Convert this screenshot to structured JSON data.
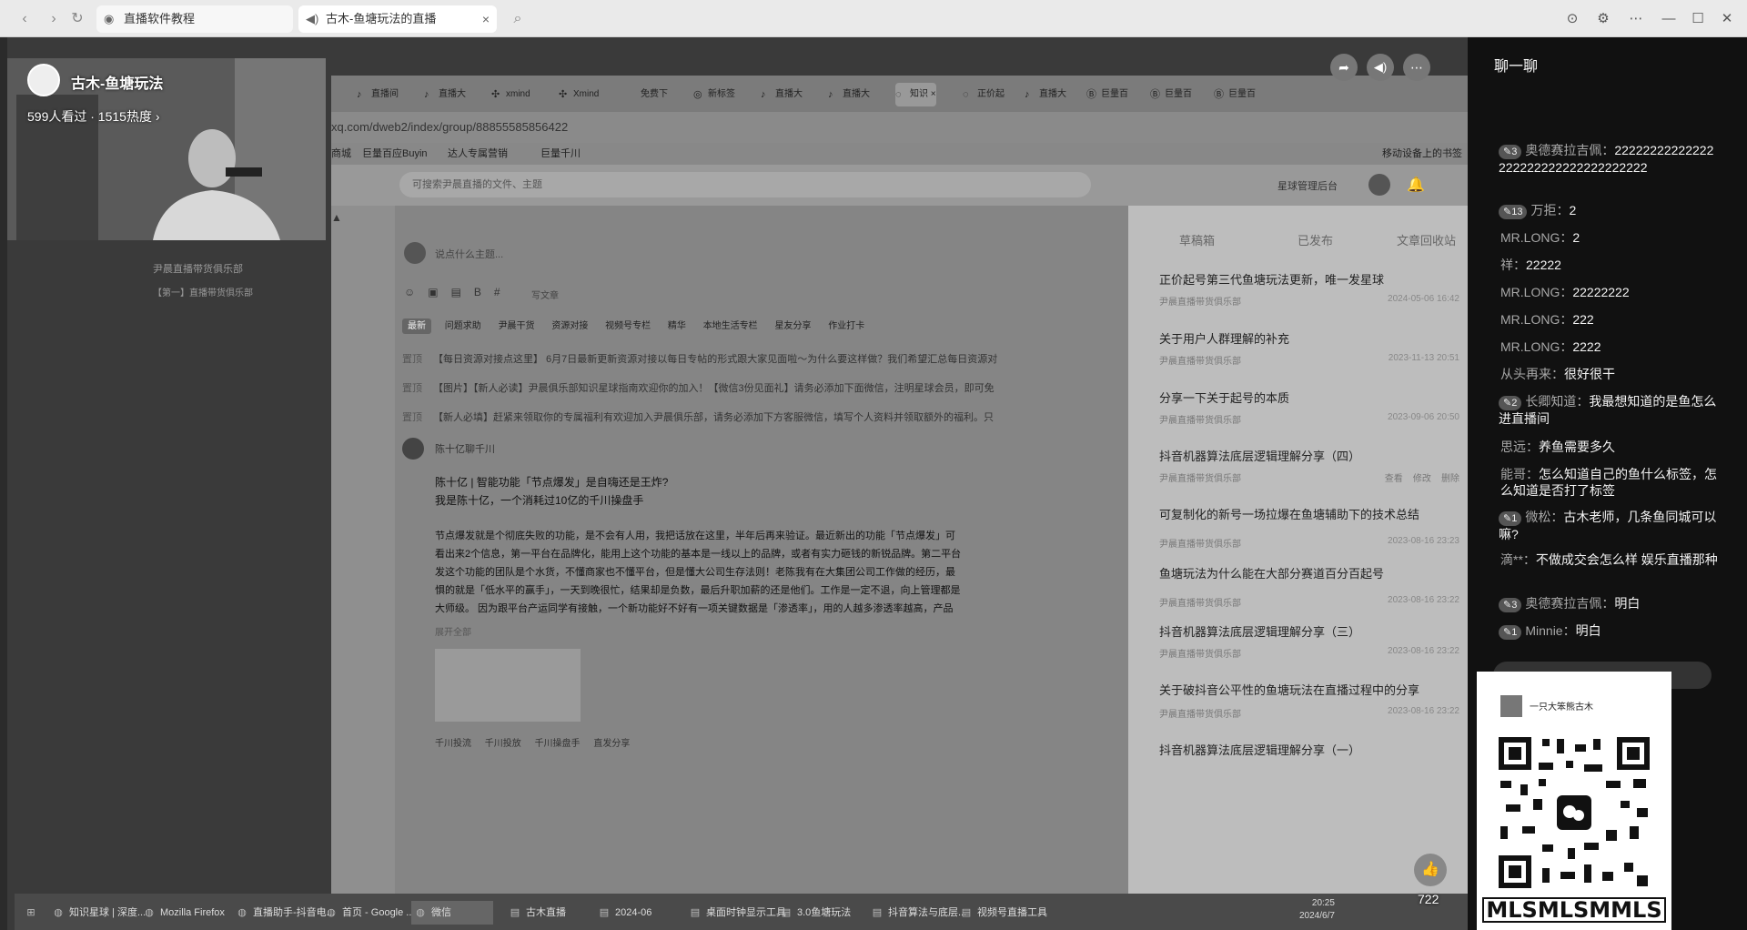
{
  "browser": {
    "tabs": [
      {
        "label": "直播软件教程"
      },
      {
        "label": "古木-鱼塘玩法的直播"
      }
    ]
  },
  "stream": {
    "streamer": "古木-鱼塘玩法",
    "viewers": "599人看过 · 1515热度",
    "inner_tabs": [
      "直播间",
      "直播大",
      "xmind",
      "Xmind",
      "免费下",
      "新标签",
      "直播大",
      "直播大",
      "知识",
      "正价起",
      "直播大",
      "巨量百",
      "巨量百",
      "巨量百"
    ],
    "address": "xq.com/dweb2/index/group/88855585856422",
    "bookmarks": [
      "商城",
      "巨量百应Buyin",
      "达人专属营销",
      "巨量千川",
      "移动设备上的书签"
    ],
    "search_placeholder": "可搜索尹晨直播的文件、主题",
    "header_right": "星球管理后台",
    "left_lines": [
      "尹晨直播带货俱乐部",
      "【第一】直播带货俱乐部"
    ],
    "composer_placeholder": "说点什么主题...",
    "composer_tool": "写文章",
    "filters": [
      "最新",
      "问题求助",
      "尹晨干货",
      "资源对接",
      "视频号专栏",
      "精华",
      "本地生活专栏",
      "星友分享",
      "作业打卡"
    ],
    "pinned": [
      {
        "tag": "置顶",
        "text": "【每日资源对接点这里】 6月7日最新更新资源对接以每日专帖的形式跟大家见面啦～为什么要这样做？我们希望汇总每日资源对"
      },
      {
        "tag": "置顶",
        "text": "【图片】【新人必读】尹晨俱乐部知识星球指南欢迎你的加入！【微信3份见面礼】请务必添加下面微信，注明星球会员，即可免"
      },
      {
        "tag": "置顶",
        "text": "【新人必填】赶紧来领取你的专属福利有欢迎加入尹晨俱乐部，请务必添加下方客服微信，填写个人资料并领取额外的福利。只"
      }
    ],
    "post": {
      "author": "陈十亿聊千川",
      "title": "陈十亿 | 智能功能「节点爆发」是自嗨还是王炸?",
      "subtitle": "我是陈十亿，一个消耗过10亿的千川操盘手",
      "body": [
        "节点爆发就是个彻底失败的功能，是不会有人用，我把话放在这里，半年后再来验证。最近新出的功能「节点爆发」可",
        "看出来2个信息，第一平台在品牌化，能用上这个功能的基本是一线以上的品牌，或者有实力砸钱的新锐品牌。第二平台",
        "发这个功能的团队是个水货，不懂商家也不懂平台，但是懂大公司生存法则！老陈我有在大集团公司工作做的经历，最",
        "惧的就是「低水平的赢手」，一天到晚很忙，结果却是负数，最后升职加薪的还是他们。工作是一定不退，向上管理都是",
        "大师级。 因为跟平台产运同学有接触，一个新功能好不好有一项关键数据是「渗透率」，用的人越多渗透率越高，产品"
      ],
      "expand": "展开全部",
      "bottom_tags": [
        "千川投流",
        "千川投放",
        "千川操盘手",
        "直发分享"
      ]
    },
    "panel": {
      "tabs": [
        "草稿箱",
        "已发布",
        "文章回收站"
      ],
      "items": [
        {
          "title": "正价起号第三代鱼塘玩法更新，唯一发星球",
          "club": "尹晨直播带货俱乐部",
          "date": "2024-05-06 16:42"
        },
        {
          "title": "关于用户人群理解的补充",
          "club": "尹晨直播带货俱乐部",
          "date": "2023-11-13 20:51"
        },
        {
          "title": "分享一下关于起号的本质",
          "club": "尹晨直播带货俱乐部",
          "date": "2023-09-06 20:50"
        },
        {
          "title": "抖音机器算法底层逻辑理解分享（四）",
          "club": "尹晨直播带货俱乐部",
          "date": ""
        },
        {
          "title": "可复制化的新号一场拉爆在鱼塘辅助下的技术总结",
          "club": "尹晨直播带货俱乐部",
          "date": "2023-08-16 23:23"
        },
        {
          "title": "鱼塘玩法为什么能在大部分赛道百分百起号",
          "club": "尹晨直播带货俱乐部",
          "date": "2023-08-16 23:22"
        },
        {
          "title": "抖音机器算法底层逻辑理解分享（三）",
          "club": "尹晨直播带货俱乐部",
          "date": "2023-08-16 23:22"
        },
        {
          "title": "关于破抖音公平性的鱼塘玩法在直播过程中的分享",
          "club": "尹晨直播带货俱乐部",
          "date": "2023-08-16 23:22"
        },
        {
          "title": "抖音机器算法底层逻辑理解分享（一）",
          "club": "",
          "date": ""
        }
      ],
      "actions": [
        "查看",
        "修改",
        "删除"
      ]
    },
    "taskbar": [
      "知识星球 | 深度...",
      "Mozilla Firefox",
      "直播助手-抖音电...",
      "首页 - Google ...",
      "微信",
      "古木直播",
      "2024-06",
      "桌面时钟显示工具",
      "3.0鱼塘玩法",
      "抖音算法与底层...",
      "视频号直播工具"
    ],
    "clock": "20:25",
    "clock_date": "2024/6/7",
    "likes": "722"
  },
  "chat": {
    "title": "聊一聊",
    "messages": [
      {
        "badge": "3",
        "name": "奥德赛拉吉佩",
        "text": "22222222222222222222222222222222222"
      },
      {
        "badge": "13",
        "name": "万拒",
        "text": "2"
      },
      {
        "badge": "",
        "name": "MR.LONG",
        "text": "2"
      },
      {
        "badge": "",
        "name": "祥",
        "text": "22222"
      },
      {
        "badge": "",
        "name": "MR.LONG",
        "text": "22222222"
      },
      {
        "badge": "",
        "name": "MR.LONG",
        "text": "222"
      },
      {
        "badge": "",
        "name": "MR.LONG",
        "text": "2222"
      },
      {
        "badge": "",
        "name": "从头再来",
        "text": "很好很干"
      },
      {
        "badge": "2",
        "name": "长卿知道",
        "text": "我最想知道的是鱼怎么进直播间"
      },
      {
        "badge": "",
        "name": "思远",
        "text": "养鱼需要多久"
      },
      {
        "badge": "",
        "name": "能哥",
        "text": "怎么知道自己的鱼什么标签，怎么知道是否打了标签"
      },
      {
        "badge": "1",
        "name": "微松",
        "text": "古木老师，几条鱼同城可以嘛?"
      },
      {
        "badge": "",
        "name": "滴**",
        "text": "不做成交会怎么样 娱乐直播那种"
      },
      {
        "badge": "3",
        "name": "奥德赛拉吉佩",
        "text": "明白"
      },
      {
        "badge": "1",
        "name": "Minnie",
        "text": "明白"
      }
    ],
    "qr_name": "一只大笨熊古木",
    "qr_caption": "MLSMLSMMLS"
  }
}
